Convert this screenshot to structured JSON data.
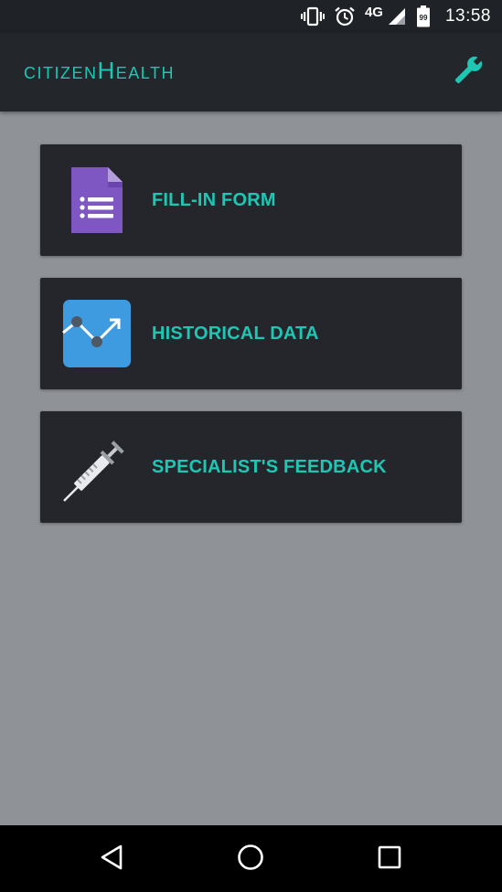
{
  "status_bar": {
    "network": "4G",
    "battery": "99",
    "time": "13:58",
    "icons": [
      "vibrate-icon",
      "alarm-icon",
      "signal-icon",
      "battery-icon"
    ]
  },
  "app_bar": {
    "title": "citizenHealth",
    "settings_icon": "wrench-icon"
  },
  "menu": {
    "items": [
      {
        "label": "FILL-IN FORM",
        "icon": "form-document-icon"
      },
      {
        "label": "HISTORICAL DATA",
        "icon": "trend-chart-icon"
      },
      {
        "label": "SPECIALIST'S FEEDBACK",
        "icon": "syringe-icon"
      }
    ]
  },
  "nav_bar": {
    "buttons": [
      "back-icon",
      "home-icon",
      "recents-icon"
    ]
  },
  "colors": {
    "accent": "#1ec7b4",
    "app_bar": "#23262b",
    "background": "#8f9297",
    "card": "#24262b",
    "form_icon": "#7e57c2",
    "chart_icon": "#3f9be0"
  }
}
